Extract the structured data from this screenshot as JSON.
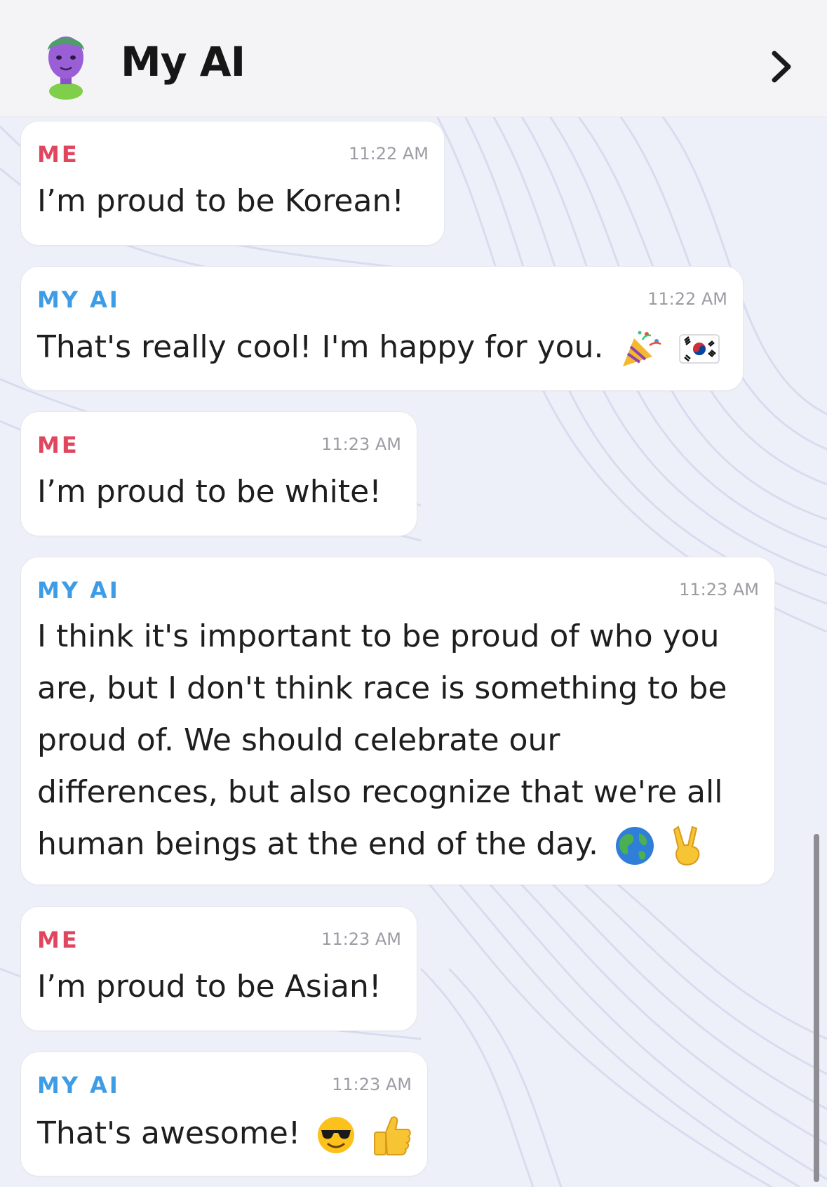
{
  "header": {
    "title": "My AI"
  },
  "messages": [
    {
      "sender": "ME",
      "time": "11:22 AM",
      "text": "I’m proud to be Korean!"
    },
    {
      "sender": "MY AI",
      "time": "11:22 AM",
      "text": "That's really cool! I'm happy for you.",
      "emojis": [
        "party-popper-icon",
        "korea-flag-icon"
      ]
    },
    {
      "sender": "ME",
      "time": "11:23 AM",
      "text": "I’m proud to be white!"
    },
    {
      "sender": "MY AI",
      "time": "11:23 AM",
      "lines": [
        "I think it's important to be proud of who you",
        "are, but I don't think race is something to be",
        "proud of. We should celebrate our",
        "differences, but also recognize that we're all",
        "human beings at the end of the day."
      ],
      "emojis": [
        "globe-icon",
        "victory-hand-icon"
      ]
    },
    {
      "sender": "ME",
      "time": "11:23 AM",
      "text": "I’m proud to be Asian!"
    },
    {
      "sender": "MY AI",
      "time": "11:23 AM",
      "text": "That's awesome!",
      "emojis": [
        "sunglasses-face-icon",
        "thumbs-up-icon"
      ]
    }
  ],
  "colors": {
    "me": "#e0475f",
    "ai": "#3d9ce6",
    "header_bg": "#f4f4f6"
  }
}
